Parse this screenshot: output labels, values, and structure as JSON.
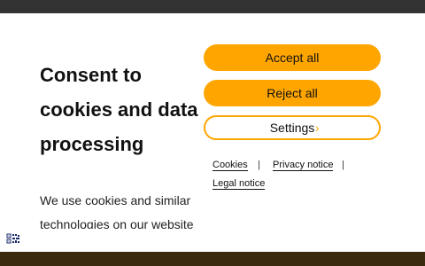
{
  "consent": {
    "title": "Consent to cookies and data processing",
    "description": "We use cookies and similar technologies on our website",
    "buttons": {
      "accept_all": "Accept all",
      "reject_all": "Reject all",
      "settings": "Settings"
    },
    "links": {
      "cookies": "Cookies",
      "privacy_notice": "Privacy notice",
      "legal_notice": "Legal notice",
      "separator": "|"
    },
    "icons": {
      "settings_chevron": "chevron-right-icon",
      "bottom_left": "qr-code-icon"
    }
  },
  "colors": {
    "accent": "#ffa500",
    "top_bar": "#333333",
    "background": "#ffffff"
  }
}
